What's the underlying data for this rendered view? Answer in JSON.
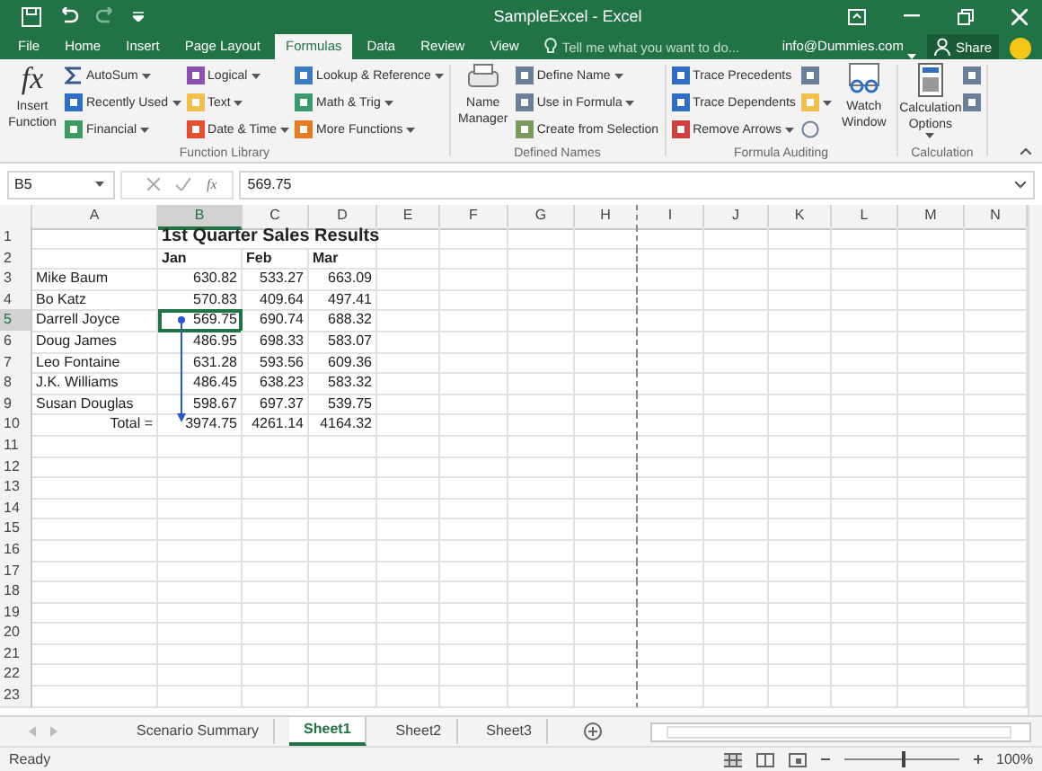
{
  "window": {
    "title": "SampleExcel - Excel"
  },
  "tabs": [
    {
      "label": "File",
      "selected": false
    },
    {
      "label": "Home",
      "selected": false
    },
    {
      "label": "Insert",
      "selected": false
    },
    {
      "label": "Page Layout",
      "selected": false
    },
    {
      "label": "Formulas",
      "selected": true
    },
    {
      "label": "Data",
      "selected": false
    },
    {
      "label": "Review",
      "selected": false
    },
    {
      "label": "View",
      "selected": false
    }
  ],
  "tell_me": {
    "placeholder": "Tell me what you want to do..."
  },
  "account": "info@Dummies.com",
  "share": "Share",
  "ribbon": {
    "groups": [
      {
        "label": "Function Library",
        "big": [
          {
            "icon": "fx",
            "label": "Insert Function"
          }
        ],
        "columns": [
          [
            {
              "label": "AutoSum",
              "dropdown": true,
              "color": "#3a5a8c",
              "kind": "sigma"
            },
            {
              "label": "Recently Used",
              "dropdown": true,
              "color": "#2e6fc4",
              "kind": "square"
            },
            {
              "label": "Financial",
              "dropdown": true,
              "color": "#3c9a5f",
              "kind": "square"
            }
          ],
          [
            {
              "label": "Logical",
              "dropdown": true,
              "color": "#8e4fb3",
              "kind": "square"
            },
            {
              "label": "Text",
              "dropdown": true,
              "color": "#f2c04c",
              "kind": "square"
            },
            {
              "label": "Date & Time",
              "dropdown": true,
              "color": "#e0502c",
              "kind": "square"
            }
          ],
          [
            {
              "label": "Lookup & Reference",
              "dropdown": true,
              "color": "#3c7bc4",
              "kind": "square"
            },
            {
              "label": "Math & Trig",
              "dropdown": true,
              "color": "#3c9a6f",
              "kind": "square"
            },
            {
              "label": "More Functions",
              "dropdown": true,
              "color": "#e87a20",
              "kind": "square"
            }
          ]
        ]
      },
      {
        "label": "Defined Names",
        "big": [
          {
            "kind": "printer",
            "label": "Name Manager"
          }
        ],
        "columns": [
          [
            {
              "label": "Define Name",
              "dropdown": true,
              "color": "#6b7f99",
              "kind": "square"
            },
            {
              "label": "Use in Formula",
              "dropdown": true,
              "color": "#6b7f99",
              "kind": "square"
            },
            {
              "label": "Create from Selection",
              "dropdown": false,
              "color": "#7a9a60",
              "kind": "square"
            }
          ]
        ]
      },
      {
        "label": "Formula Auditing",
        "columns": [
          [
            {
              "label": "Trace Precedents",
              "dropdown": false,
              "color": "#2e6fc4",
              "kind": "square"
            },
            {
              "label": "Trace Dependents",
              "dropdown": false,
              "color": "#2e6fc4",
              "kind": "square"
            },
            {
              "label": "Remove Arrows",
              "dropdown": true,
              "color": "#d04040",
              "kind": "square"
            }
          ],
          [
            {
              "dropdown": false,
              "color": "#6b7f99",
              "kind": "square"
            },
            {
              "dropdown": true,
              "color": "#f2c04c",
              "kind": "square"
            },
            {
              "dropdown": false,
              "color": "#6b7f99",
              "kind": "circle"
            }
          ]
        ],
        "big_after": [
          {
            "kind": "glasses",
            "label": "Watch Window"
          }
        ]
      },
      {
        "label": "Calculation",
        "big": [
          {
            "kind": "calculator",
            "label": "Calculation Options",
            "dropdown": true
          }
        ],
        "columns": [
          [
            {
              "dropdown": false,
              "color": "#6b7f99",
              "kind": "square"
            },
            {
              "dropdown": false,
              "color": "#6b7f99",
              "kind": "square"
            }
          ]
        ]
      }
    ]
  },
  "formula_bar": {
    "name_box": "B5",
    "fx": "fx",
    "value": "569.75"
  },
  "columns": [
    {
      "label": "A",
      "selected": false
    },
    {
      "label": "B",
      "selected": true
    },
    {
      "label": "C",
      "selected": false
    },
    {
      "label": "D",
      "selected": false
    },
    {
      "label": "E",
      "selected": false
    },
    {
      "label": "F",
      "selected": false
    },
    {
      "label": "G",
      "selected": false
    },
    {
      "label": "H",
      "selected": false
    },
    {
      "label": "I",
      "selected": false
    },
    {
      "label": "J",
      "selected": false
    },
    {
      "label": "K",
      "selected": false
    },
    {
      "label": "L",
      "selected": false
    },
    {
      "label": "M",
      "selected": false
    },
    {
      "label": "N",
      "selected": false
    }
  ],
  "rows": [
    {
      "number": "1",
      "kind": "title",
      "title": "1st Quarter Sales Results",
      "selected": false
    },
    {
      "number": "2",
      "kind": "header",
      "values": [
        "Jan",
        "Feb",
        "Mar"
      ],
      "selected": false
    },
    {
      "number": "3",
      "kind": "data",
      "name": "Mike Baum",
      "values": [
        "630.82",
        "533.27",
        "663.09"
      ],
      "selected": false
    },
    {
      "number": "4",
      "kind": "data",
      "name": "Bo Katz",
      "values": [
        "570.83",
        "409.64",
        "497.41"
      ],
      "selected": false
    },
    {
      "number": "5",
      "kind": "data",
      "name": "Darrell Joyce",
      "values": [
        "569.75",
        "690.74",
        "688.32"
      ],
      "selected": true
    },
    {
      "number": "6",
      "kind": "data",
      "name": "Doug James",
      "values": [
        "486.95",
        "698.33",
        "583.07"
      ],
      "selected": false
    },
    {
      "number": "7",
      "kind": "data",
      "name": "Leo Fontaine",
      "values": [
        "631.28",
        "593.56",
        "609.36"
      ],
      "selected": false
    },
    {
      "number": "8",
      "kind": "data",
      "name": "J.K. Williams",
      "values": [
        "486.45",
        "638.23",
        "583.32"
      ],
      "selected": false
    },
    {
      "number": "9",
      "kind": "data",
      "name": "Susan Douglas",
      "values": [
        "598.67",
        "697.37",
        "539.75"
      ],
      "selected": false
    },
    {
      "number": "10",
      "kind": "total",
      "name": "Total =",
      "values": [
        "3974.75",
        "4261.14",
        "4164.32"
      ],
      "selected": false
    },
    {
      "number": "11",
      "kind": "empty",
      "selected": false
    },
    {
      "number": "12",
      "kind": "empty",
      "selected": false
    },
    {
      "number": "13",
      "kind": "empty",
      "selected": false
    },
    {
      "number": "14",
      "kind": "empty",
      "selected": false
    },
    {
      "number": "15",
      "kind": "empty",
      "selected": false
    },
    {
      "number": "16",
      "kind": "empty",
      "selected": false
    },
    {
      "number": "17",
      "kind": "empty",
      "selected": false
    },
    {
      "number": "18",
      "kind": "empty",
      "selected": false
    },
    {
      "number": "19",
      "kind": "empty",
      "selected": false
    },
    {
      "number": "20",
      "kind": "empty",
      "selected": false
    },
    {
      "number": "21",
      "kind": "empty",
      "selected": false
    },
    {
      "number": "22",
      "kind": "empty",
      "selected": false
    },
    {
      "number": "23",
      "kind": "empty",
      "selected": false
    }
  ],
  "sheet_tabs": [
    {
      "label": "Scenario Summary",
      "selected": false
    },
    {
      "label": "Sheet1",
      "selected": true
    },
    {
      "label": "Sheet2",
      "selected": false
    },
    {
      "label": "Sheet3",
      "selected": false
    }
  ],
  "status_bar": {
    "text": "Ready",
    "zoom": {
      "level": 0.5,
      "reading": "100%"
    }
  }
}
